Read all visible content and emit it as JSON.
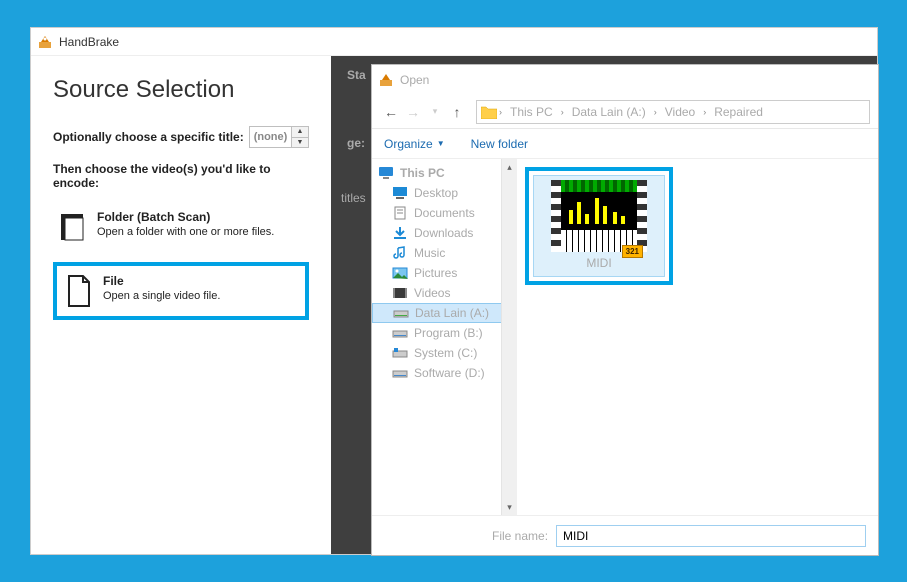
{
  "app": {
    "title": "HandBrake"
  },
  "source": {
    "heading": "Source Selection",
    "optional_label": "Optionally choose a specific title:",
    "spin_value": "(none)",
    "instruction": "Then choose the video(s) you'd like to encode:",
    "folder": {
      "title": "Folder (Batch Scan)",
      "desc": "Open a folder with one or more files."
    },
    "file": {
      "title": "File",
      "desc": "Open a single video file."
    }
  },
  "bg": {
    "sta": "Sta",
    "ge": "ge:",
    "titles": "titles"
  },
  "dialog": {
    "title": "Open",
    "breadcrumb": [
      "This PC",
      "Data Lain (A:)",
      "Video",
      "Repaired"
    ],
    "toolbar": {
      "organize": "Organize",
      "newfolder": "New folder"
    },
    "tree": {
      "root": "This PC",
      "items": [
        "Desktop",
        "Documents",
        "Downloads",
        "Music",
        "Pictures",
        "Videos",
        "Data Lain (A:)",
        "Program (B:)",
        "System (C:)",
        "Software (D:)"
      ]
    },
    "file": {
      "name": "MIDI",
      "badge": "321"
    },
    "filename_label": "File name:",
    "filename_value": "MIDI"
  }
}
